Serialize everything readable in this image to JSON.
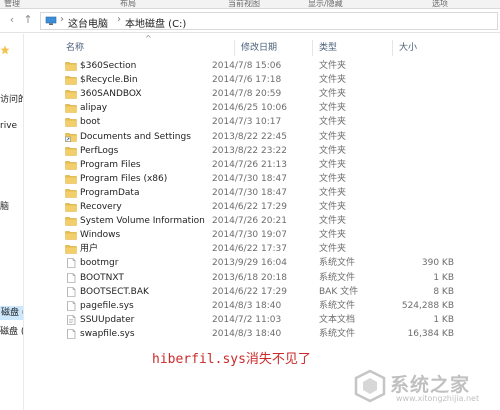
{
  "ribbon": {
    "tabs": [
      "管理",
      "布局",
      "当前视图",
      "显示/隐藏",
      "选项"
    ]
  },
  "address": {
    "crumbs": [
      "这台电脑",
      "本地磁盘 (C:)"
    ]
  },
  "sidebar": {
    "items": [
      "",
      "访问的位置",
      "rive",
      "",
      "脑",
      "磁盘 (C:)",
      "磁盘 (D:)"
    ]
  },
  "columns": {
    "name": "名称",
    "date": "修改日期",
    "type": "类型",
    "size": "大小"
  },
  "files": [
    {
      "name": "$360Section",
      "date": "2014/7/8 15:06",
      "type": "文件夹",
      "size": "",
      "icon": "folder-icon"
    },
    {
      "name": "$Recycle.Bin",
      "date": "2014/7/6 17:18",
      "type": "文件夹",
      "size": "",
      "icon": "folder-icon"
    },
    {
      "name": "360SANDBOX",
      "date": "2014/7/8 20:59",
      "type": "文件夹",
      "size": "",
      "icon": "folder-icon"
    },
    {
      "name": "alipay",
      "date": "2014/6/25 10:06",
      "type": "文件夹",
      "size": "",
      "icon": "folder-icon"
    },
    {
      "name": "boot",
      "date": "2014/7/3 10:17",
      "type": "文件夹",
      "size": "",
      "icon": "folder-icon"
    },
    {
      "name": "Documents and Settings",
      "date": "2013/8/22 22:45",
      "type": "文件夹",
      "size": "",
      "icon": "shortcut-folder-icon"
    },
    {
      "name": "PerfLogs",
      "date": "2013/8/22 23:22",
      "type": "文件夹",
      "size": "",
      "icon": "folder-icon"
    },
    {
      "name": "Program Files",
      "date": "2014/7/26 21:13",
      "type": "文件夹",
      "size": "",
      "icon": "folder-icon"
    },
    {
      "name": "Program Files (x86)",
      "date": "2014/7/30 18:47",
      "type": "文件夹",
      "size": "",
      "icon": "folder-icon"
    },
    {
      "name": "ProgramData",
      "date": "2014/7/30 18:47",
      "type": "文件夹",
      "size": "",
      "icon": "folder-icon"
    },
    {
      "name": "Recovery",
      "date": "2014/6/22 17:29",
      "type": "文件夹",
      "size": "",
      "icon": "folder-icon"
    },
    {
      "name": "System Volume Information",
      "date": "2014/7/26 20:21",
      "type": "文件夹",
      "size": "",
      "icon": "folder-icon"
    },
    {
      "name": "Windows",
      "date": "2014/7/30 19:07",
      "type": "文件夹",
      "size": "",
      "icon": "folder-icon"
    },
    {
      "name": "用户",
      "date": "2014/6/22 17:37",
      "type": "文件夹",
      "size": "",
      "icon": "folder-icon"
    },
    {
      "name": "bootmgr",
      "date": "2013/9/29 16:04",
      "type": "系统文件",
      "size": "390 KB",
      "icon": "file-icon"
    },
    {
      "name": "BOOTNXT",
      "date": "2013/6/18 20:18",
      "type": "系统文件",
      "size": "1 KB",
      "icon": "file-icon"
    },
    {
      "name": "BOOTSECT.BAK",
      "date": "2014/6/22 17:29",
      "type": "BAK 文件",
      "size": "8 KB",
      "icon": "file-icon"
    },
    {
      "name": "pagefile.sys",
      "date": "2014/8/3 18:40",
      "type": "系统文件",
      "size": "524,288 KB",
      "icon": "file-icon"
    },
    {
      "name": "SSUUpdater",
      "date": "2014/7/2 11:03",
      "type": "文本文档",
      "size": "1 KB",
      "icon": "text-file-icon"
    },
    {
      "name": "swapfile.sys",
      "date": "2014/8/3 18:40",
      "type": "系统文件",
      "size": "16,384 KB",
      "icon": "file-icon"
    }
  ],
  "caption": "hiberfil.sys消失不见了",
  "watermark": {
    "text": "系统之家",
    "url": "www.xitongzhijia.net"
  },
  "colors": {
    "folder": "#e8bd4a",
    "header_text": "#4c607a",
    "caption": "#cc2a2a",
    "selection": "#cce8ff"
  }
}
